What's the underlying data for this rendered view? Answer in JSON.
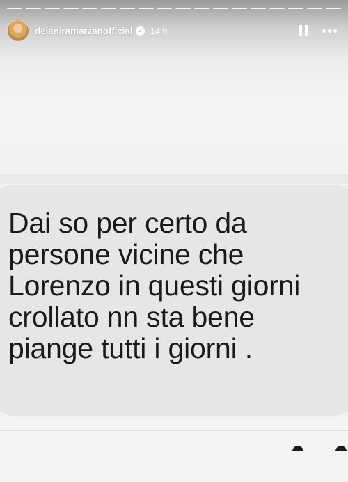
{
  "story": {
    "progress_segments": 18,
    "username": "deianiramarzanofficial",
    "verified_glyph": "✓",
    "time_ago": "14 h",
    "icons": {
      "avatar": "avatar",
      "verified": "verified-badge-icon",
      "pause": "pause-icon",
      "more": "more-options-icon"
    }
  },
  "message": {
    "text": "Dai so per certo da\npersone vicine che\nLorenzo in questi giorni\ncrollato nn sta bene\npiange tutti i giorni ."
  }
}
